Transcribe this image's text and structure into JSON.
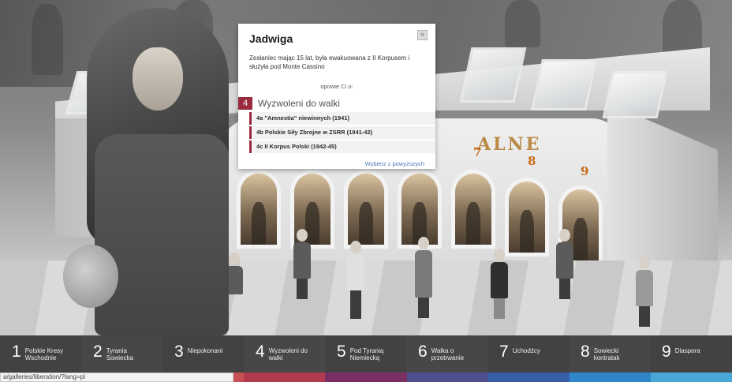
{
  "building": {
    "sign": "ALNE",
    "arch_numbers": [
      "7",
      "8",
      "9"
    ]
  },
  "popup": {
    "title": "Jadwiga",
    "close_icon": "close-icon",
    "description": "Zesłaniec mając 15 lat, była ewakuowana z II Korpusem i służyła pod Monte Cassino",
    "tell": "opowie Ci o:",
    "chapter": {
      "number": "4",
      "name": "Wyzwoleni do walki"
    },
    "items": [
      "4a \"Amnestia\" niewinnych (1941)",
      "4b Polskie Siły Zbrojne w ZSRR (1941-42)",
      "4c II Korpus Polski (1942-45)"
    ],
    "choose": "Wybierz z powyższych",
    "accent_color": "#9a2a3e"
  },
  "nav": {
    "items": [
      {
        "num": "1",
        "label": "Polskie Kresy Wschodnie"
      },
      {
        "num": "2",
        "label": "Tyrania Sowiecka"
      },
      {
        "num": "3",
        "label": "Niepokonani"
      },
      {
        "num": "4",
        "label": "Wyzwoleni do walki"
      },
      {
        "num": "5",
        "label": "Pod Tyranią Niemiecką"
      },
      {
        "num": "6",
        "label": "Walka o przetrwanie"
      },
      {
        "num": "7",
        "label": "Uchodźcy"
      },
      {
        "num": "8",
        "label": "Sowiecki kontratak"
      },
      {
        "num": "9",
        "label": "Diaspora"
      }
    ],
    "colors": [
      "#9c9c9c",
      "#b0b0b0",
      "#c94f57",
      "#b13a4e",
      "#7a2f63",
      "#4d4f8f",
      "#365ea6",
      "#2f86c8",
      "#4aa5d9"
    ]
  },
  "status_bar": {
    "url": "a/galleries/liberation/?lang=pl"
  }
}
